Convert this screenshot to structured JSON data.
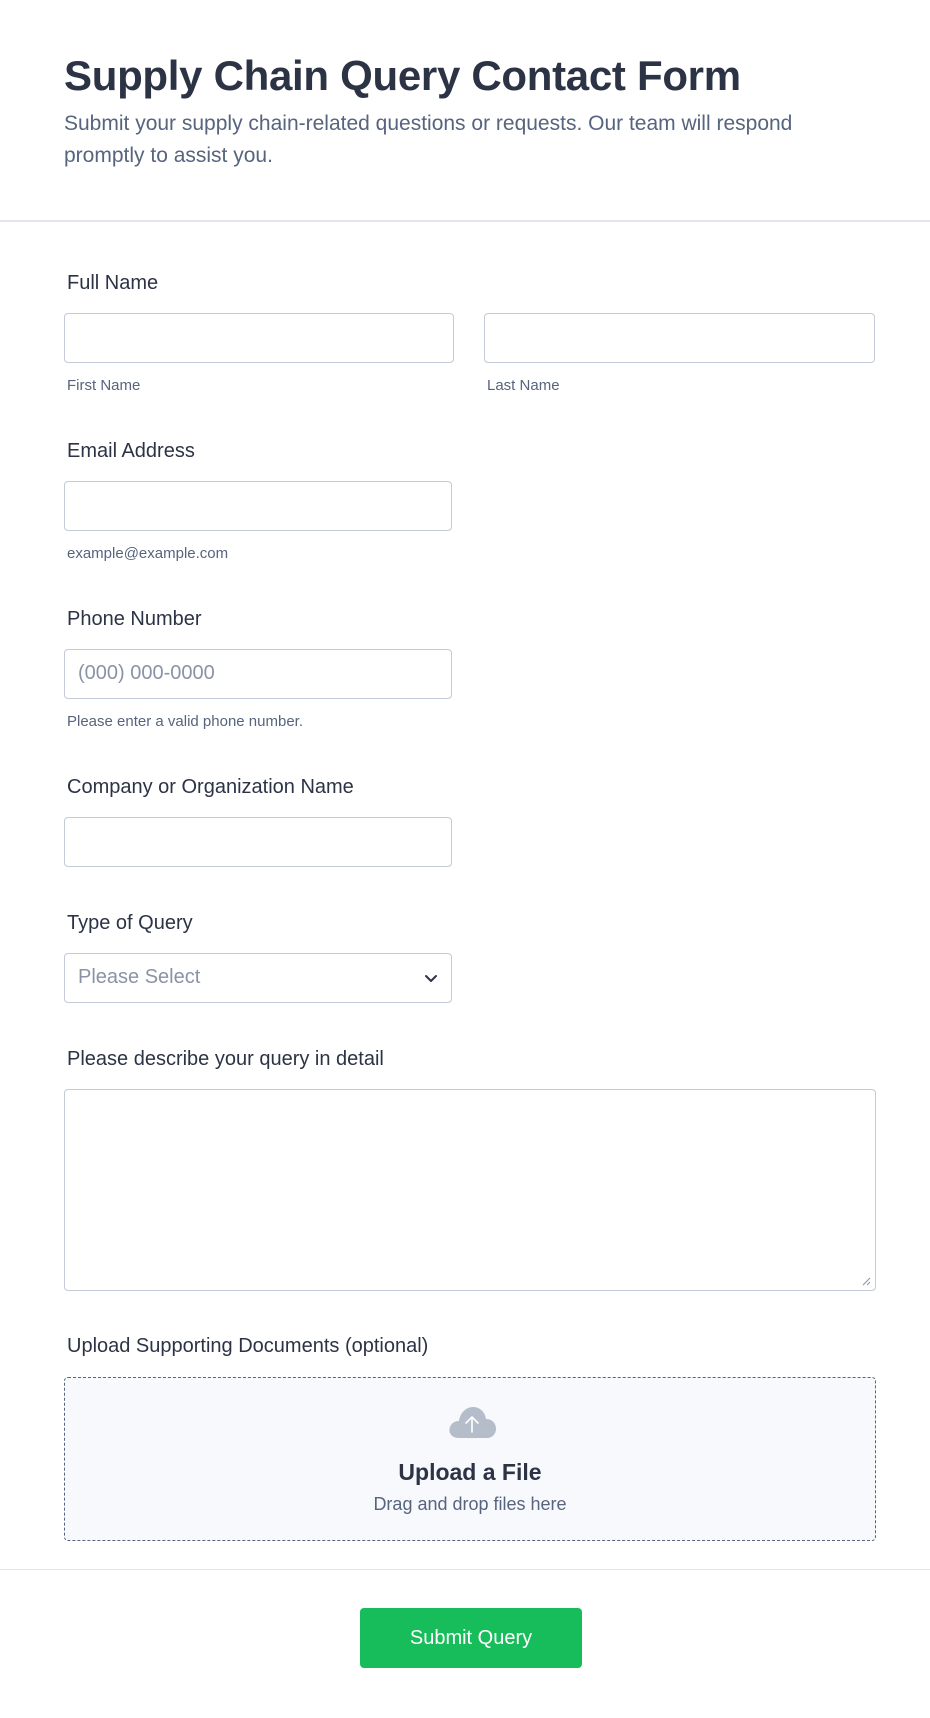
{
  "header": {
    "title": "Supply Chain Query Contact Form",
    "subtitle": "Submit your supply chain-related questions or requests. Our team will respond promptly to assist you."
  },
  "fields": {
    "full_name": {
      "label": "Full Name",
      "first_sublabel": "First Name",
      "last_sublabel": "Last Name",
      "first_value": "",
      "last_value": ""
    },
    "email": {
      "label": "Email Address",
      "sublabel": "example@example.com",
      "value": ""
    },
    "phone": {
      "label": "Phone Number",
      "placeholder": "(000) 000-0000",
      "sublabel": "Please enter a valid phone number."
    },
    "company": {
      "label": "Company or Organization Name",
      "value": ""
    },
    "query_type": {
      "label": "Type of Query",
      "selected": "Please Select",
      "icon": "chevron-down-icon"
    },
    "description": {
      "label": "Please describe your query in detail",
      "value": ""
    },
    "upload": {
      "label": "Upload Supporting Documents (optional)",
      "title": "Upload a File",
      "subtitle": "Drag and drop files here",
      "icon": "cloud-upload-icon"
    }
  },
  "footer": {
    "submit_label": "Submit Query",
    "submit_color": "#18bd5b"
  },
  "colors": {
    "text": "#2c3345",
    "muted": "#57647e",
    "border": "#c3cad8"
  }
}
